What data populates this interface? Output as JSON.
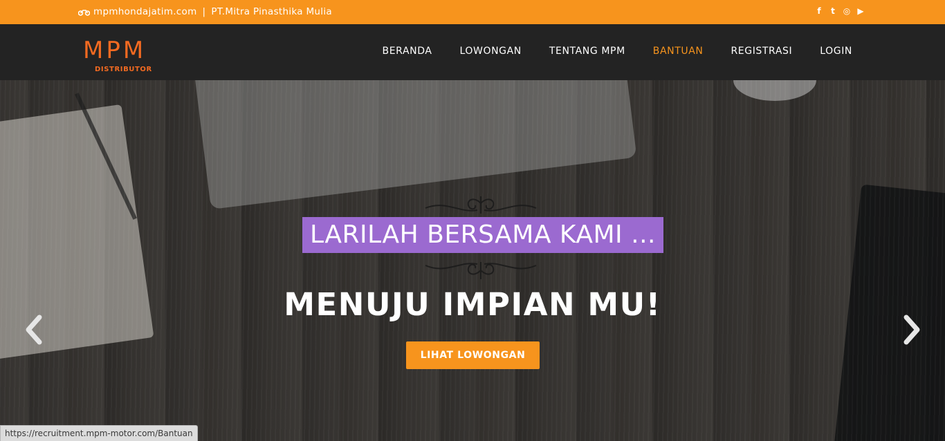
{
  "topbar": {
    "site": "mpmhondajatim.com",
    "separator": "|",
    "company": "PT.Mitra Pinasthika Mulia",
    "social": [
      {
        "icon": "facebook-icon",
        "glyph": "f"
      },
      {
        "icon": "twitter-icon",
        "glyph": "t"
      },
      {
        "icon": "instagram-icon",
        "glyph": "◎"
      },
      {
        "icon": "youtube-icon",
        "glyph": "▶"
      }
    ]
  },
  "logo": {
    "text": "MPM",
    "subtext": "DISTRIBUTOR"
  },
  "nav": {
    "items": [
      "BERANDA",
      "LOWONGAN",
      "TENTANG MPM",
      "BANTUAN",
      "REGISTRASI",
      "LOGIN"
    ],
    "active": "BANTUAN"
  },
  "hero": {
    "tagline": "LARILAH BERSAMA KAMI ...",
    "headline": "MENUJU IMPIAN MU!",
    "cta": "LIHAT LOWONGAN"
  },
  "status_url": "https://recruitment.mpm-motor.com/Bantuan",
  "colors": {
    "accent": "#f7941d",
    "tagline_bg": "#9b6ad0",
    "nav_bg": "#232323",
    "logo": "#f26a21"
  }
}
